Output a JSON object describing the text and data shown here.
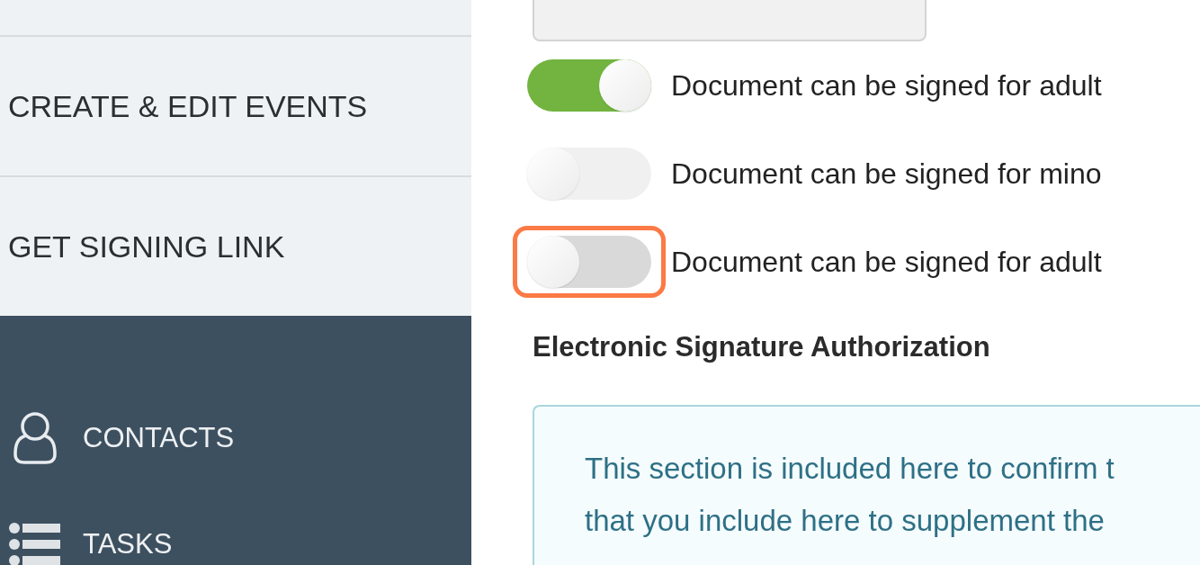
{
  "sidebar": {
    "menu_items": [
      {
        "label": "CREATE & EDIT EVENTS"
      },
      {
        "label": "GET SIGNING LINK"
      }
    ],
    "nav_items": [
      {
        "label": "CONTACTS",
        "kind": "person"
      },
      {
        "label": "TASKS",
        "kind": "list"
      }
    ]
  },
  "form": {
    "toggles": [
      {
        "label": "Document can be signed for adult",
        "on": true,
        "highlighted": false
      },
      {
        "label": "Document can be signed for mino",
        "on": false,
        "highlighted": false
      },
      {
        "label": "Document can be signed for adult",
        "on": false,
        "highlighted": true
      }
    ],
    "section_heading": "Electronic Signature Authorization",
    "info_box": {
      "lines": [
        "This section is included here to confirm t",
        "that you include here to supplement the"
      ]
    }
  }
}
